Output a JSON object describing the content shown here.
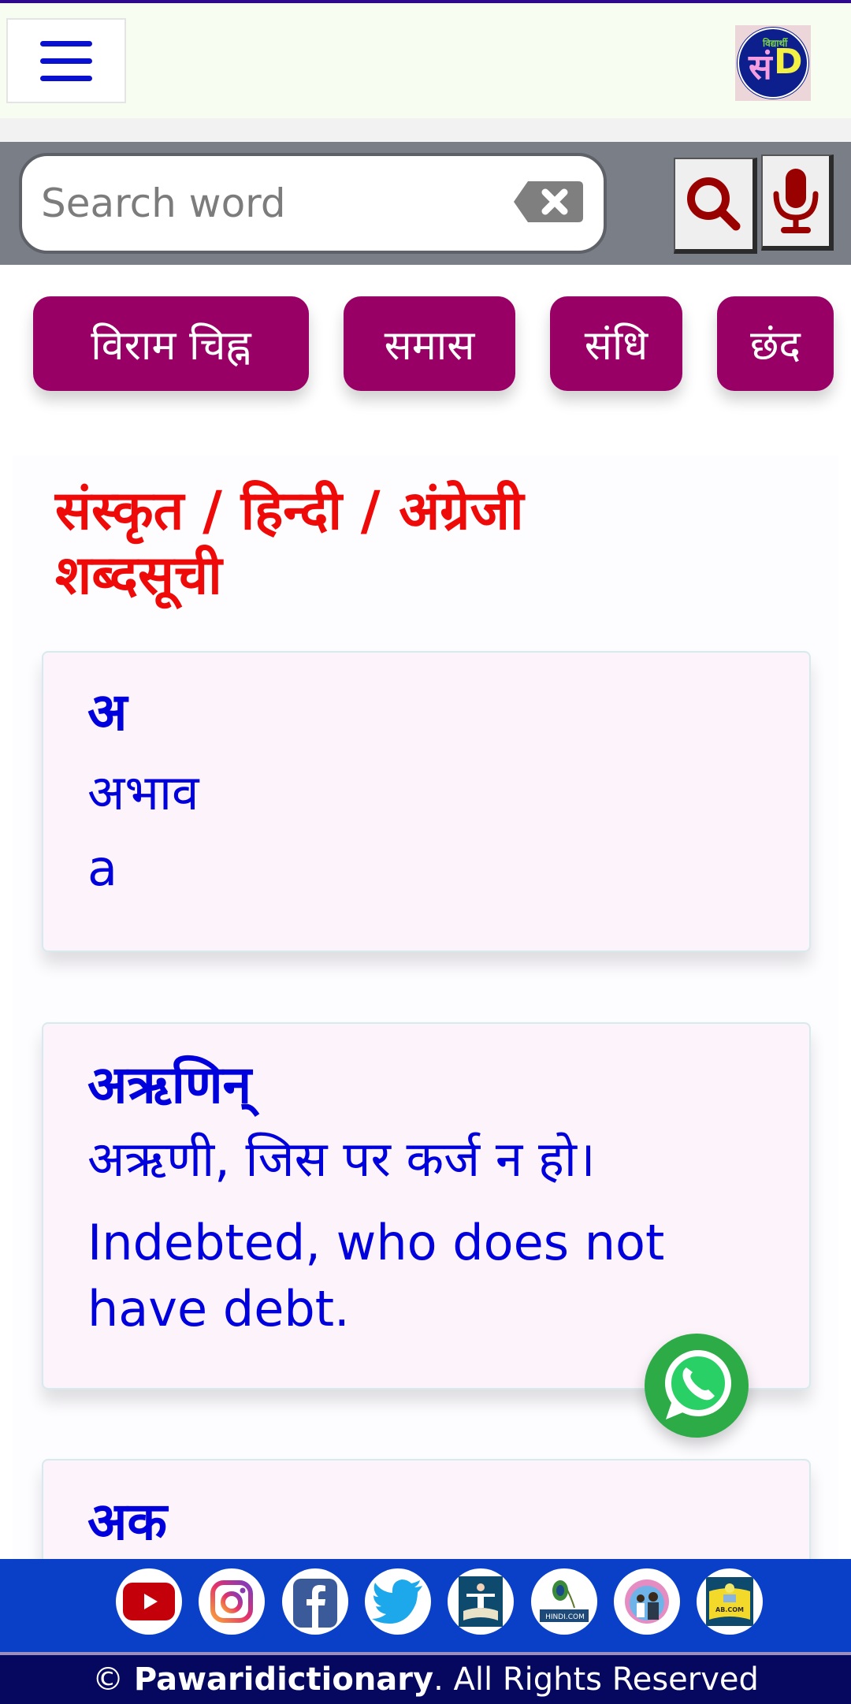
{
  "header": {
    "menu_icon": "hamburger-menu-icon",
    "logo": {
      "main": "सं",
      "letter": "D",
      "top": "विद्यार्थी"
    }
  },
  "search": {
    "placeholder": "Search word",
    "value": "",
    "clear_icon": "backspace-clear-icon",
    "search_icon": "search-icon",
    "mic_icon": "microphone-icon",
    "icon_color": "#990000"
  },
  "chips": [
    {
      "label": "विराम चिह्न"
    },
    {
      "label": "समास"
    },
    {
      "label": "संधि"
    },
    {
      "label": "छंद"
    }
  ],
  "page": {
    "title": "संस्कृत / हिन्दी / अंग्रेजी शब्दसूची"
  },
  "entries": [
    {
      "word": "अ",
      "hindi": "अभाव",
      "english": "a"
    },
    {
      "word": "अऋणिन्",
      "hindi": "अऋणी, जिस पर कर्ज न हो।",
      "english": "Indebted, who does not have debt."
    },
    {
      "word": "अक",
      "hindi": "",
      "english": ""
    }
  ],
  "social": [
    {
      "name": "youtube"
    },
    {
      "name": "instagram"
    },
    {
      "name": "facebook"
    },
    {
      "name": "twitter"
    },
    {
      "name": "sahitya-site",
      "label": ""
    },
    {
      "name": "hindi-com",
      "label": "HINDI.COM"
    },
    {
      "name": "competition",
      "label": ""
    },
    {
      "name": "ab-com",
      "label": "AB.COM"
    }
  ],
  "footer": {
    "copyright": "©",
    "brand": "Pawaridictionary",
    "rest": ". All Rights Reserved"
  },
  "colors": {
    "chip_bg": "#990066",
    "title_red": "#ef0a0a",
    "entry_blue": "#0000dd",
    "social_bar": "#0a3fc8",
    "footer_bg": "#06075e"
  }
}
